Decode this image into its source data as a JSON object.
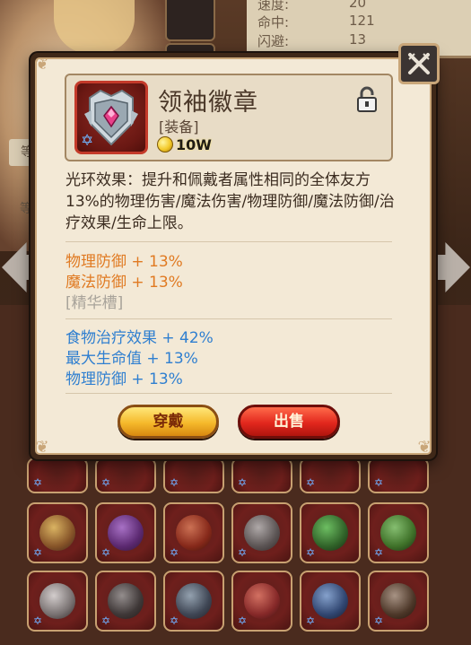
{
  "background": {
    "stats": [
      {
        "label": "速度:",
        "value": "20"
      },
      {
        "label": "命中:",
        "value": "121"
      },
      {
        "label": "闪避:",
        "value": "13"
      }
    ],
    "left_label": "等",
    "left_label2": "等"
  },
  "item": {
    "name": "领袖徽章",
    "type": "[装备]",
    "price": "10W",
    "icon": "leader-badge-icon",
    "lock_icon": "lock-open-icon"
  },
  "description": "光环效果：提升和佩戴者属性相同的全体友方13%的物理伤害/魔法伤害/物理防御/魔法防御/治疗效果/生命上限。",
  "base_stats": [
    "物理防御 + 13%",
    "魔法防御 + 13%"
  ],
  "essence_slot": "[精华槽]",
  "bonus_stats": [
    "食物治疗效果 + 42%",
    "最大生命值 + 13%",
    "物理防御 + 13%"
  ],
  "buttons": {
    "equip": "穿戴",
    "sell": "出售"
  },
  "colors": {
    "base_stat": "#e07a22",
    "bonus_stat": "#2f7fd0",
    "essence": "#a8a39a",
    "equip_button": "#f5b92b",
    "sell_button": "#e2271d"
  }
}
